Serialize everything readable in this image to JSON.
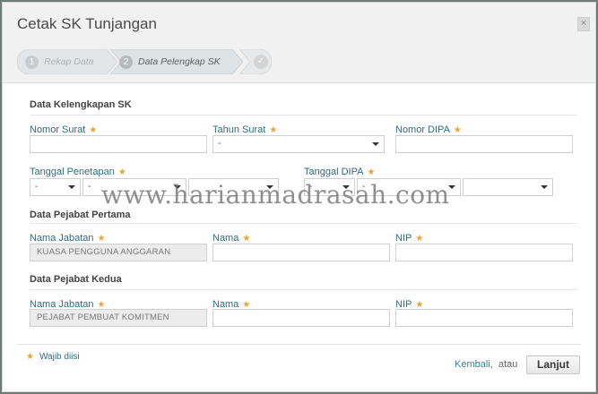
{
  "dialog": {
    "title": "Cetak SK Tunjangan",
    "close_label": "×"
  },
  "steps": [
    {
      "number": "1",
      "label": "Rekap Data",
      "state": "done"
    },
    {
      "number": "2",
      "label": "Data Pelengkap SK",
      "state": "active"
    },
    {
      "icon": "check-icon",
      "state": "pending"
    }
  ],
  "sections": {
    "kelengkapan": "Data Kelengkapan SK",
    "pejabat_pertama": "Data Pejabat Pertama",
    "pejabat_kedua": "Data Pejabat Kedua"
  },
  "fields": {
    "nomor_surat": {
      "label": "Nomor Surat",
      "value": ""
    },
    "tahun_surat": {
      "label": "Tahun Surat",
      "value": "-"
    },
    "nomor_dipa": {
      "label": "Nomor DIPA",
      "value": ""
    },
    "tanggal_penetapan": {
      "label": "Tanggal Penetapan",
      "day": "-",
      "month": "-",
      "year": ""
    },
    "tanggal_dipa": {
      "label": "Tanggal DIPA",
      "day": "-",
      "month": "-",
      "year": ""
    },
    "pejabat1_jabatan": {
      "label": "Nama Jabatan",
      "value": "KUASA PENGGUNA ANGGARAN"
    },
    "pejabat1_nama": {
      "label": "Nama",
      "value": ""
    },
    "pejabat1_nip": {
      "label": "NIP",
      "value": ""
    },
    "pejabat2_jabatan": {
      "label": "Nama Jabatan",
      "value": "PEJABAT PEMBUAT KOMITMEN"
    },
    "pejabat2_nama": {
      "label": "Nama",
      "value": ""
    },
    "pejabat2_nip": {
      "label": "NIP",
      "value": ""
    }
  },
  "required_star": "★",
  "footer": {
    "required_note": "Wajib diisi",
    "back_label": "Kembali,",
    "or_label": "atau",
    "next_label": "Lanjut"
  },
  "watermark": "www.harianmadrasah.com",
  "colors": {
    "label_teal": "#2b6f7e",
    "required_star": "#e8a33a",
    "link_blue": "#3d7f97"
  }
}
